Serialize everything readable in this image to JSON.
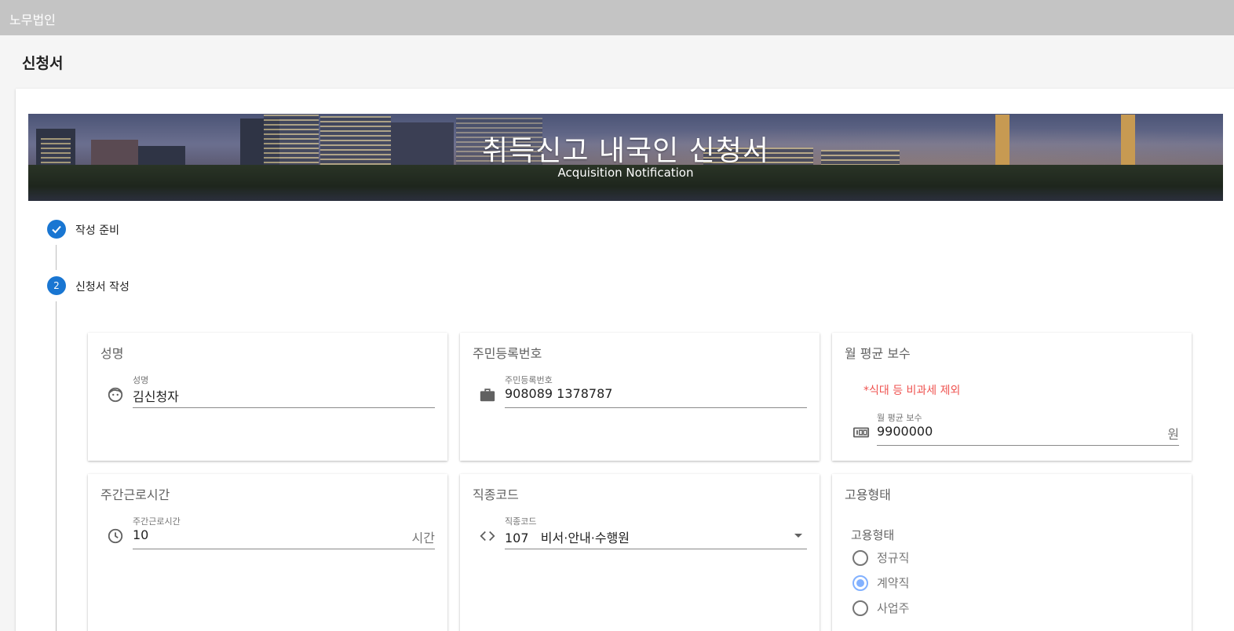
{
  "app": {
    "brand": "노무법인"
  },
  "page": {
    "title": "신청서"
  },
  "banner": {
    "title": "취득신고 내국인 신청서",
    "subtitle": "Acquisition Notification"
  },
  "stepper": {
    "steps": [
      {
        "label": "작성 준비",
        "state": "complete",
        "icon": "check-icon"
      },
      {
        "label": "신청서 작성",
        "state": "active",
        "number": "2"
      }
    ]
  },
  "form": {
    "name": {
      "card_title": "성명",
      "label": "성명",
      "value": "김신청자",
      "icon": "face-icon"
    },
    "resident_number": {
      "card_title": "주민등록번호",
      "label": "주민등록번호",
      "value": "908089 1378787",
      "icon": "briefcase-icon"
    },
    "monthly_pay": {
      "card_title": "월 평균 보수",
      "note": "*식대 등 비과세 제외",
      "label": "월 평균 보수",
      "value": "9900000",
      "suffix": "원",
      "icon": "number-box-icon"
    },
    "weekly_hours": {
      "card_title": "주간근로시간",
      "label": "주간근로시간",
      "value": "10",
      "suffix": "시간",
      "icon": "clock-icon"
    },
    "job_code": {
      "card_title": "직종코드",
      "label": "직종코드",
      "value": "107   비서·안내·수행원",
      "icon": "code-icon"
    },
    "employment_type": {
      "card_title": "고용형태",
      "group_label": "고용형태",
      "options": [
        "정규직",
        "계약직",
        "사업주"
      ],
      "selected": "계약직"
    }
  },
  "colors": {
    "primary": "#1976d2",
    "radio_checked": "#82b1ff",
    "note": "#ef5350",
    "topbar": "#c4c4c4"
  }
}
